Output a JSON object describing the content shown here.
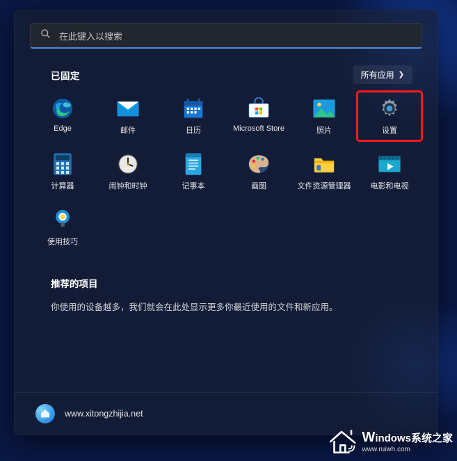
{
  "search": {
    "placeholder": "在此键入以搜索"
  },
  "pinned": {
    "title": "已固定",
    "all_apps": "所有应用",
    "apps": [
      {
        "id": "edge",
        "label": "Edge"
      },
      {
        "id": "mail",
        "label": "邮件"
      },
      {
        "id": "calendar",
        "label": "日历"
      },
      {
        "id": "store",
        "label": "Microsoft Store"
      },
      {
        "id": "photos",
        "label": "照片"
      },
      {
        "id": "settings",
        "label": "设置",
        "highlight": true
      },
      {
        "id": "calculator",
        "label": "计算器"
      },
      {
        "id": "clock",
        "label": "闹钟和时钟"
      },
      {
        "id": "notepad",
        "label": "记事本"
      },
      {
        "id": "paint",
        "label": "画图"
      },
      {
        "id": "explorer",
        "label": "文件资源管理器"
      },
      {
        "id": "movies",
        "label": "电影和电视"
      },
      {
        "id": "tips",
        "label": "使用技巧"
      }
    ]
  },
  "recommended": {
    "title": "推荐的项目",
    "text": "你使用的设备越多，我们就会在此处显示更多你最近使用的文件和新应用。"
  },
  "footer": {
    "url": "www.xitongzhijia.net"
  },
  "watermark": {
    "brand": "indows",
    "sub": "www.ruiwh.com"
  }
}
